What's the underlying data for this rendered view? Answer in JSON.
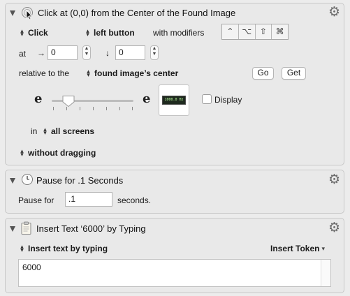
{
  "action1": {
    "title": "Click at (0,0) from the Center of the Found Image",
    "click_type": "Click",
    "button": "left button",
    "with_modifiers_label": "with modifiers",
    "modifiers": [
      "⌃",
      "⌥",
      "⇧",
      "⌘"
    ],
    "at_label": "at",
    "x_arrow": "→",
    "x_value": "0",
    "y_arrow": "↓",
    "y_value": "0",
    "relative_label": "relative to the",
    "relative_value": "found image’s center",
    "go_label": "Go",
    "get_label": "Get",
    "fuzz_left_label": "e",
    "fuzz_right_label": "e",
    "display_label": "Display",
    "display_checked": false,
    "preview_text": "1000.0 Hz",
    "in_label": "in",
    "screens_value": "all screens",
    "drag_value": "without dragging"
  },
  "action2": {
    "title": "Pause for .1 Seconds",
    "pause_label": "Pause for",
    "pause_value": ".1",
    "seconds_label": "seconds."
  },
  "action3": {
    "title": "Insert Text ‘6000’ by Typing",
    "mode": "Insert text by typing",
    "token_label": "Insert Token",
    "text_value": "6000"
  },
  "icons": {
    "gear": "⚙",
    "stepper_up": "▲",
    "stepper_down": "▼",
    "updown": "⌃⌄"
  }
}
